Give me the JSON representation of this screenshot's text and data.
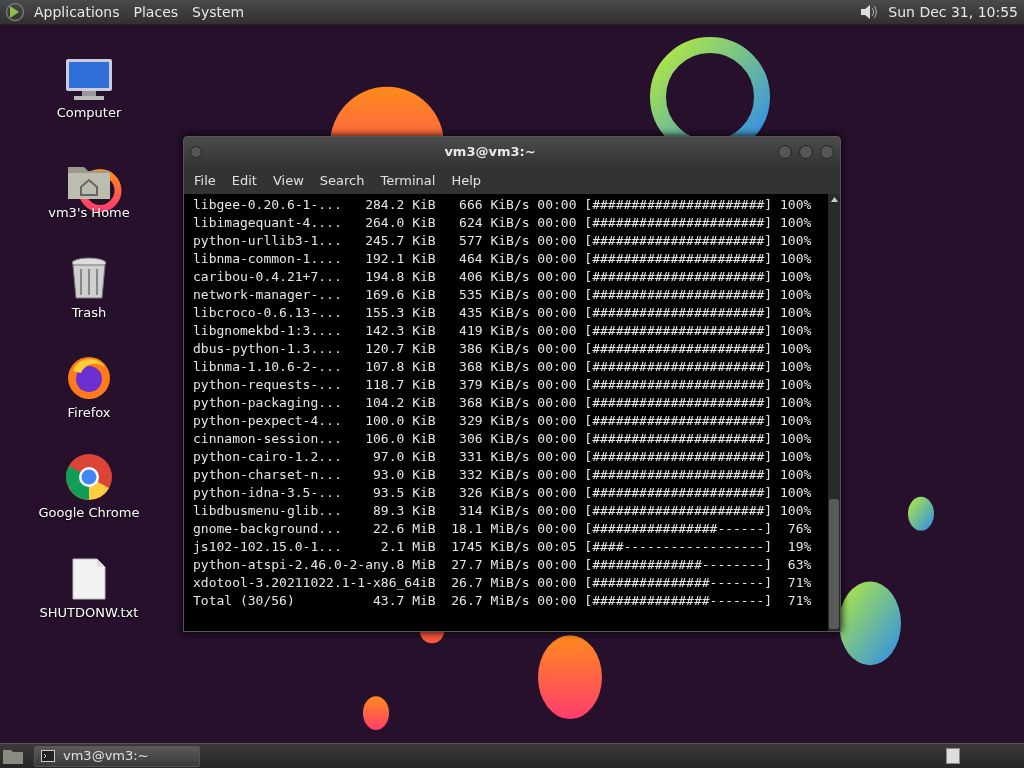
{
  "top_panel": {
    "menus": [
      "Applications",
      "Places",
      "System"
    ],
    "clock": "Sun Dec 31, 10:55"
  },
  "desktop_icons": [
    {
      "kind": "computer",
      "label": "Computer"
    },
    {
      "kind": "home",
      "label": "vm3's Home"
    },
    {
      "kind": "trash",
      "label": "Trash"
    },
    {
      "kind": "firefox",
      "label": "Firefox"
    },
    {
      "kind": "chrome",
      "label": "Google Chrome"
    },
    {
      "kind": "file",
      "label": "SHUTDONW.txt"
    }
  ],
  "terminal": {
    "title": "vm3@vm3:~",
    "menu": [
      "File",
      "Edit",
      "View",
      "Search",
      "Terminal",
      "Help"
    ],
    "lines": [
      "libgee-0.20.6-1-...   284.2 KiB   666 KiB/s 00:00 [######################] 100%",
      "libimagequant-4....   264.0 KiB   624 KiB/s 00:00 [######################] 100%",
      "python-urllib3-1...   245.7 KiB   577 KiB/s 00:00 [######################] 100%",
      "libnma-common-1....   192.1 KiB   464 KiB/s 00:00 [######################] 100%",
      "caribou-0.4.21+7...   194.8 KiB   406 KiB/s 00:00 [######################] 100%",
      "network-manager-...   169.6 KiB   535 KiB/s 00:00 [######################] 100%",
      "libcroco-0.6.13-...   155.3 KiB   435 KiB/s 00:00 [######################] 100%",
      "libgnomekbd-1:3....   142.3 KiB   419 KiB/s 00:00 [######################] 100%",
      "dbus-python-1.3....   120.7 KiB   386 KiB/s 00:00 [######################] 100%",
      "libnma-1.10.6-2-...   107.8 KiB   368 KiB/s 00:00 [######################] 100%",
      "python-requests-...   118.7 KiB   379 KiB/s 00:00 [######################] 100%",
      "python-packaging...   104.2 KiB   368 KiB/s 00:00 [######################] 100%",
      "python-pexpect-4...   100.0 KiB   329 KiB/s 00:00 [######################] 100%",
      "cinnamon-session...   106.0 KiB   306 KiB/s 00:00 [######################] 100%",
      "python-cairo-1.2...    97.0 KiB   331 KiB/s 00:00 [######################] 100%",
      "python-charset-n...    93.0 KiB   332 KiB/s 00:00 [######################] 100%",
      "python-idna-3.5-...    93.5 KiB   326 KiB/s 00:00 [######################] 100%",
      "libdbusmenu-glib...    89.3 KiB   314 KiB/s 00:00 [######################] 100%",
      "gnome-background...    22.6 MiB  18.1 MiB/s 00:00 [################------]  76%",
      "js102-102.15.0-1...     2.1 MiB  1745 KiB/s 00:05 [####------------------]  19%",
      "python-atspi-2.46.0-2-any.8 MiB  27.7 MiB/s 00:00 [##############--------]  63%",
      "xdotool-3.20211022.1-1-x86_64iB  26.7 MiB/s 00:00 [###############-------]  71%",
      "Total (30/56)          43.7 MiB  26.7 MiB/s 00:00 [###############-------]  71%"
    ]
  },
  "taskbar": {
    "windows": [
      {
        "label": "vm3@vm3:~",
        "selected": false
      }
    ]
  }
}
